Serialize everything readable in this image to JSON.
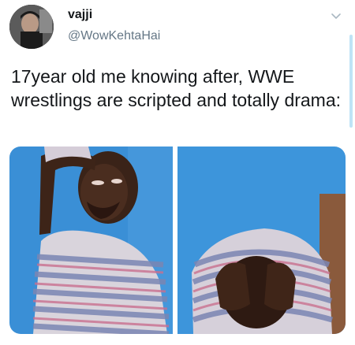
{
  "tweet": {
    "display_name": "vajji",
    "handle": "@WowKehtaHai",
    "text": "17year old me knowing after, WWE wrestlings are scripted and totally drama:",
    "avatar_icon": "profile-photo",
    "menu_icon": "chevron-down-icon"
  },
  "media": {
    "count": 2,
    "left_image": "crying-boy-photo",
    "right_image": "crying-boy-covering-face-photo"
  },
  "colors": {
    "text_primary": "#14171a",
    "text_secondary": "#657786",
    "media_background": "#3a8fd6",
    "scrollbar": "#bfe3f6"
  }
}
